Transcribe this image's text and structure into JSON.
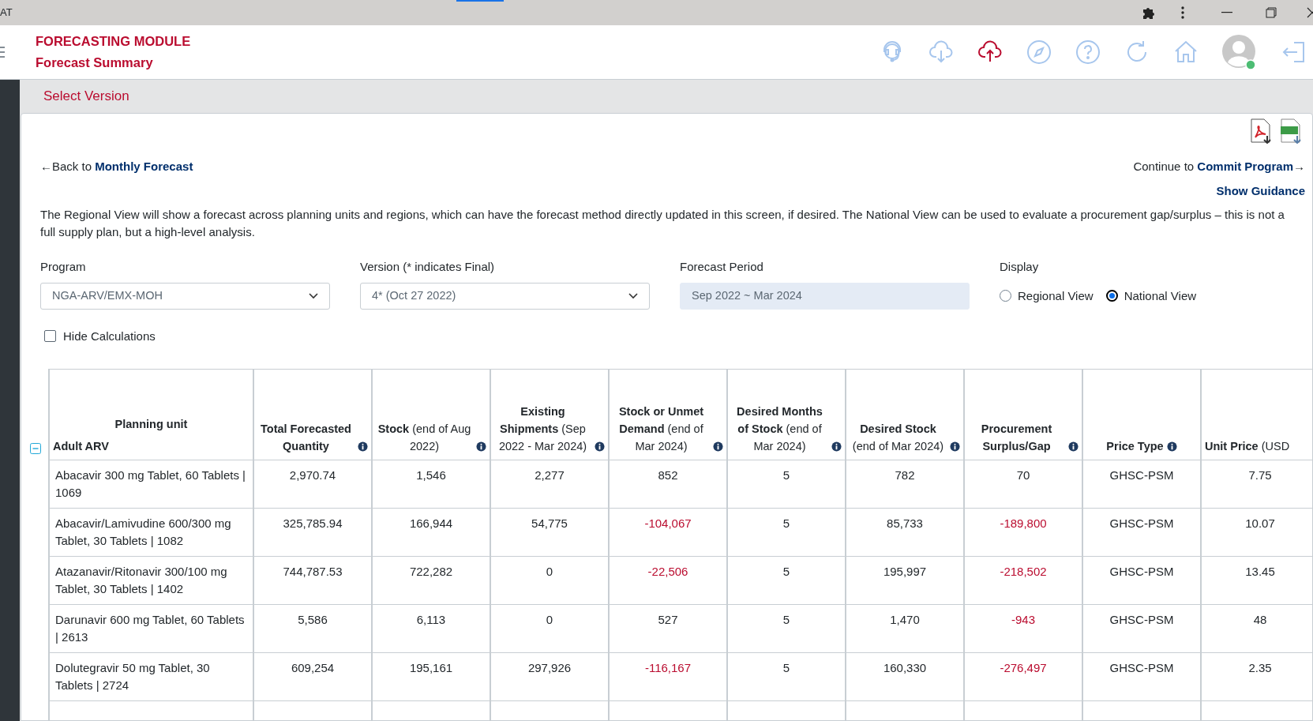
{
  "browser": {
    "tab_fragment": "AT"
  },
  "header": {
    "module_title": "FORECASTING MODULE",
    "page_title": "Forecast Summary"
  },
  "version_bar": {
    "title": "Select Version"
  },
  "nav": {
    "back": "←Back to **Monthly Forecast**",
    "forward": "Continue to **Commit Program**→",
    "guidance": "Show Guidance"
  },
  "description": "The Regional View will show a forecast across planning units and regions, which can have the forecast method directly updated in this screen, if desired. The National View can be used to evaluate a procurement gap/surplus – this is not a full supply plan, but a high-level analysis.",
  "filters": {
    "program": {
      "label": "Program",
      "value": "NGA-ARV/EMX-MOH"
    },
    "version": {
      "label": "Version (* indicates Final)",
      "value": "4* (Oct 27 2022)"
    },
    "forecast_period": {
      "label": "Forecast Period",
      "value": "Sep 2022 ~ Mar 2024",
      "disabled": true
    },
    "display": {
      "label": "Display",
      "options": [
        {
          "label": "Regional View",
          "selected": false
        },
        {
          "label": "National View",
          "selected": true
        }
      ]
    }
  },
  "hide_calculations": {
    "label": "Hide Calculations",
    "checked": false
  },
  "table": {
    "columns": [
      {
        "label": "Planning unit",
        "info": false
      },
      {
        "label": "**Total Forecasted Quantity**",
        "info": true
      },
      {
        "label": "**Stock** (end of Aug 2022)",
        "info": true
      },
      {
        "label": "**Existing Shipments** (Sep 2022 - Mar 2024)",
        "info": true
      },
      {
        "label": "**Stock or Unmet Demand** (end of Mar 2024)",
        "info": true
      },
      {
        "label": "**Desired Months of Stock** (end of Mar 2024)",
        "info": true
      },
      {
        "label": "**Desired Stock** (end of Mar 2024)",
        "info": true
      },
      {
        "label": "**Procurement Surplus/Gap**",
        "info": true
      },
      {
        "label": "**Price Type**",
        "info": true
      },
      {
        "label": "**Unit Price** (USD",
        "info": false
      }
    ],
    "group": {
      "label": "Adult ARV",
      "expanded": true
    },
    "rows": [
      {
        "cells": [
          {
            "text": "Abacavir 300 mg Tablet, 60 Tablets | 1069",
            "negative": false
          },
          {
            "text": "2,970.74",
            "negative": false
          },
          {
            "text": "1,546",
            "negative": false
          },
          {
            "text": "2,277",
            "negative": false
          },
          {
            "text": "852",
            "negative": false
          },
          {
            "text": "5",
            "negative": false
          },
          {
            "text": "782",
            "negative": false
          },
          {
            "text": "70",
            "negative": false
          },
          {
            "text": "GHSC-PSM",
            "negative": false
          },
          {
            "text": "7.75",
            "negative": false
          }
        ]
      },
      {
        "cells": [
          {
            "text": "Abacavir/Lamivudine 600/300 mg Tablet, 30 Tablets | 1082",
            "negative": false
          },
          {
            "text": "325,785.94",
            "negative": false
          },
          {
            "text": "166,944",
            "negative": false
          },
          {
            "text": "54,775",
            "negative": false
          },
          {
            "text": "-104,067",
            "negative": true
          },
          {
            "text": "5",
            "negative": false
          },
          {
            "text": "85,733",
            "negative": false
          },
          {
            "text": "-189,800",
            "negative": true
          },
          {
            "text": "GHSC-PSM",
            "negative": false
          },
          {
            "text": "10.07",
            "negative": false
          }
        ]
      },
      {
        "cells": [
          {
            "text": "Atazanavir/Ritonavir 300/100 mg Tablet, 30 Tablets | 1402",
            "negative": false
          },
          {
            "text": "744,787.53",
            "negative": false
          },
          {
            "text": "722,282",
            "negative": false
          },
          {
            "text": "0",
            "negative": false
          },
          {
            "text": "-22,506",
            "negative": true
          },
          {
            "text": "5",
            "negative": false
          },
          {
            "text": "195,997",
            "negative": false
          },
          {
            "text": "-218,502",
            "negative": true
          },
          {
            "text": "GHSC-PSM",
            "negative": false
          },
          {
            "text": "13.45",
            "negative": false
          }
        ]
      },
      {
        "cells": [
          {
            "text": "Darunavir 600 mg Tablet, 60 Tablets | 2613",
            "negative": false
          },
          {
            "text": "5,586",
            "negative": false
          },
          {
            "text": "6,113",
            "negative": false
          },
          {
            "text": "0",
            "negative": false
          },
          {
            "text": "527",
            "negative": false
          },
          {
            "text": "5",
            "negative": false
          },
          {
            "text": "1,470",
            "negative": false
          },
          {
            "text": "-943",
            "negative": true
          },
          {
            "text": "GHSC-PSM",
            "negative": false
          },
          {
            "text": "48",
            "negative": false
          }
        ]
      },
      {
        "cells": [
          {
            "text": "Dolutegravir 50 mg Tablet, 30 Tablets | 2724",
            "negative": false
          },
          {
            "text": "609,254",
            "negative": false
          },
          {
            "text": "195,161",
            "negative": false
          },
          {
            "text": "297,926",
            "negative": false
          },
          {
            "text": "-116,167",
            "negative": true
          },
          {
            "text": "5",
            "negative": false
          },
          {
            "text": "160,330",
            "negative": false
          },
          {
            "text": "-276,497",
            "negative": true
          },
          {
            "text": "GHSC-PSM",
            "negative": false
          },
          {
            "text": "2.35",
            "negative": false
          }
        ]
      }
    ]
  }
}
